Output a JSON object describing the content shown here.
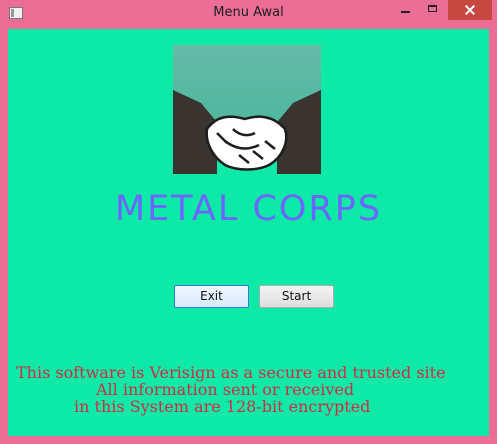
{
  "window": {
    "title": "Menu Awal"
  },
  "logo": {
    "icon": "handshake-icon",
    "brand_text": "METAL CORPS",
    "brand_color": "#6b66ff"
  },
  "buttons": {
    "exit_label": "Exit",
    "start_label": "Start"
  },
  "notice": {
    "line1": "This software is Verisign as a secure and trusted site",
    "line2": "All information sent or received",
    "line3": "in this System are 128-bit encrypted",
    "color": "#ce2d44"
  },
  "colors": {
    "frame": "#ec6e96",
    "background": "#0de9a6",
    "close_button": "#c7483f"
  }
}
